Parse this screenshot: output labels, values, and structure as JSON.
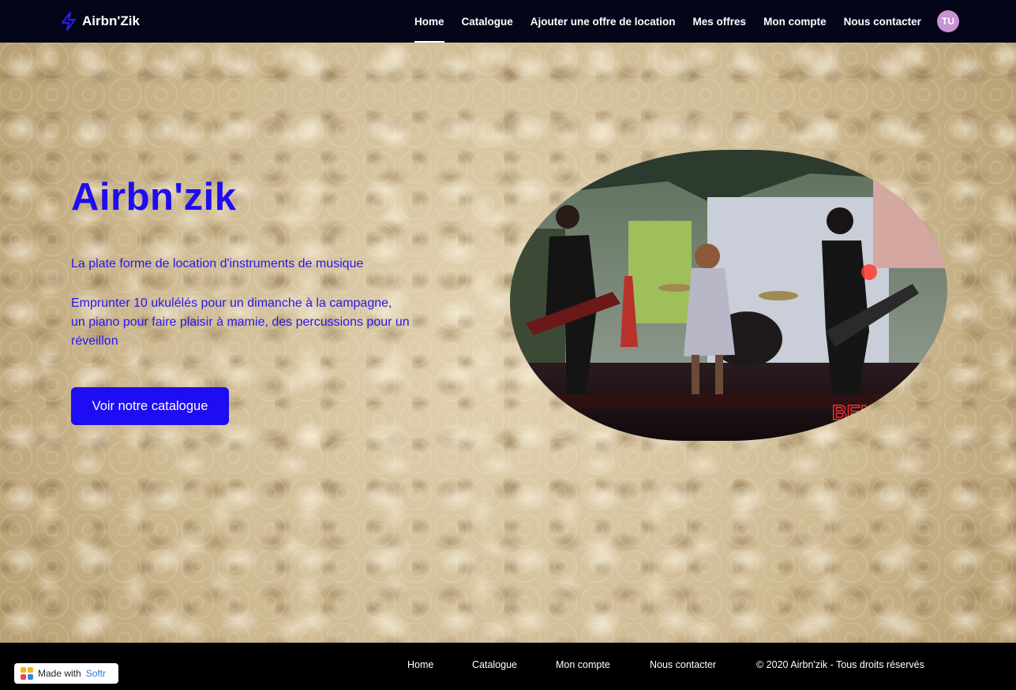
{
  "navbar": {
    "brand": "Airbn'Zik",
    "links": [
      {
        "label": "Home",
        "active": true
      },
      {
        "label": "Catalogue",
        "active": false
      },
      {
        "label": "Ajouter une offre de location",
        "active": false
      },
      {
        "label": "Mes offres",
        "active": false
      },
      {
        "label": "Mon compte",
        "active": false
      },
      {
        "label": "Nous contacter",
        "active": false
      }
    ],
    "avatar_initials": "TU",
    "avatar_color": "#c793d3"
  },
  "hero": {
    "title": "Airbn'zik",
    "subtitle": "La plate forme de location d'instruments de musique",
    "description_lines": [
      "Emprunter 10 ukulélés pour un dimanche à la campagne,",
      "un piano pour faire plaisir à mamie, des percussions pour un",
      "réveillon"
    ],
    "cta_label": "Voir notre catalogue",
    "accent_color": "#1e0cf2",
    "image_sign_text": "BEN"
  },
  "footer": {
    "links": [
      "Home",
      "Catalogue",
      "Mon compte",
      "Nous contacter"
    ],
    "copyright": "© 2020 Airbn'zik - Tous droits réservés",
    "made_with_prefix": "Made with",
    "made_with_brand": "Softr"
  }
}
